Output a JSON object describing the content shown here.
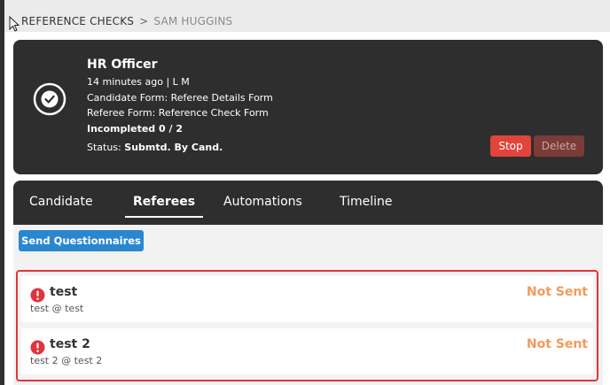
{
  "breadcrumb": {
    "root": "REFERENCE CHECKS",
    "separator": ">",
    "current": "SAM HUGGINS"
  },
  "summary": {
    "title": "HR Officer",
    "meta": "14 minutes ago | L M",
    "candidate_form": "Candidate Form: Referee Details Form",
    "referee_form": "Referee Form: Reference Check Form",
    "incompleted": "Incompleted 0 / 2",
    "status_label": "Status:",
    "status_value": "Submtd. By Cand.",
    "stop_label": "Stop",
    "delete_label": "Delete"
  },
  "tabs": [
    {
      "label": "Candidate",
      "active": false
    },
    {
      "label": "Referees",
      "active": true
    },
    {
      "label": "Automations",
      "active": false
    },
    {
      "label": "Timeline",
      "active": false
    }
  ],
  "actions": {
    "send_questionnaires": "Send Questionnaires"
  },
  "referees": [
    {
      "name": "test",
      "email": "test @ test",
      "status": "Not Sent"
    },
    {
      "name": "test 2",
      "email": "test 2 @ test 2",
      "status": "Not Sent"
    }
  ],
  "icons": {
    "cursor": "mouse-pointer-icon",
    "summary": "check-circle-icon",
    "referee_alert": "exclamation-circle-icon"
  },
  "colors": {
    "dark_panel": "#2e2e2e",
    "stop": "#e0443a",
    "delete": "#7b3b37",
    "primary": "#2a87cf",
    "alert": "#e0343a",
    "not_sent": "#f39a5a"
  }
}
